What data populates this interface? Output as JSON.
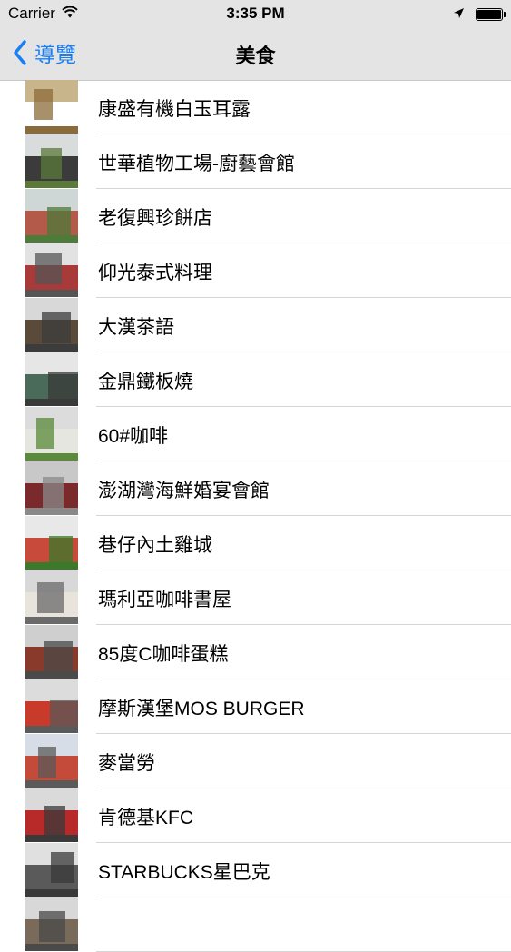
{
  "status_bar": {
    "carrier": "Carrier",
    "time": "3:35 PM"
  },
  "nav": {
    "back_label": "導覽",
    "title": "美食",
    "accent_color": "#1a7ef4"
  },
  "items": [
    {
      "label": "康盛有機白玉耳露",
      "thumb": [
        "#c9b58c",
        "#ffffff",
        "#8b6b3a"
      ]
    },
    {
      "label": "世華植物工場-廚藝會館",
      "thumb": [
        "#d8dcdc",
        "#3b3b3b",
        "#5b7a3a"
      ]
    },
    {
      "label": "老復興珍餅店",
      "thumb": [
        "#cfd6d6",
        "#b45a4a",
        "#4e7a3a"
      ]
    },
    {
      "label": "仰光泰式料理",
      "thumb": [
        "#e2e2e2",
        "#a83a3a",
        "#555555"
      ]
    },
    {
      "label": "大漢茶語",
      "thumb": [
        "#d8d8d8",
        "#5a4a3a",
        "#3c3c3c"
      ]
    },
    {
      "label": "金鼎鐵板燒",
      "thumb": [
        "#e6e6e6",
        "#4a6a5a",
        "#3a3a3a"
      ]
    },
    {
      "label": "60#咖啡",
      "thumb": [
        "#dcdcdc",
        "#e6e6e0",
        "#5a8a3a"
      ]
    },
    {
      "label": "澎湖灣海鮮婚宴會館",
      "thumb": [
        "#c8c8c8",
        "#7a2a2a",
        "#8a8a8a"
      ]
    },
    {
      "label": "巷仔內土雞城",
      "thumb": [
        "#e8e8e8",
        "#c84a3a",
        "#3a7a2a"
      ]
    },
    {
      "label": "瑪利亞咖啡書屋",
      "thumb": [
        "#d8d8d8",
        "#e8e4dc",
        "#6a6a6a"
      ]
    },
    {
      "label": "85度C咖啡蛋糕",
      "thumb": [
        "#cfcfcf",
        "#8a3a2a",
        "#4a4a4a"
      ]
    },
    {
      "label": "摩斯漢堡MOS BURGER",
      "thumb": [
        "#dcdcdc",
        "#c83a2a",
        "#5a5a5a"
      ]
    },
    {
      "label": "麥當勞",
      "thumb": [
        "#d6dde6",
        "#c44a3a",
        "#5a5a5a"
      ]
    },
    {
      "label": "肯德基KFC",
      "thumb": [
        "#dadada",
        "#b82a2a",
        "#3a3a3a"
      ]
    },
    {
      "label": "STARBUCKS星巴克",
      "thumb": [
        "#e0e0e0",
        "#5a5a5a",
        "#3a3a3a"
      ]
    },
    {
      "label": "",
      "thumb": [
        "#d8d8d8",
        "#7a6a5a",
        "#4a4a4a"
      ]
    }
  ]
}
